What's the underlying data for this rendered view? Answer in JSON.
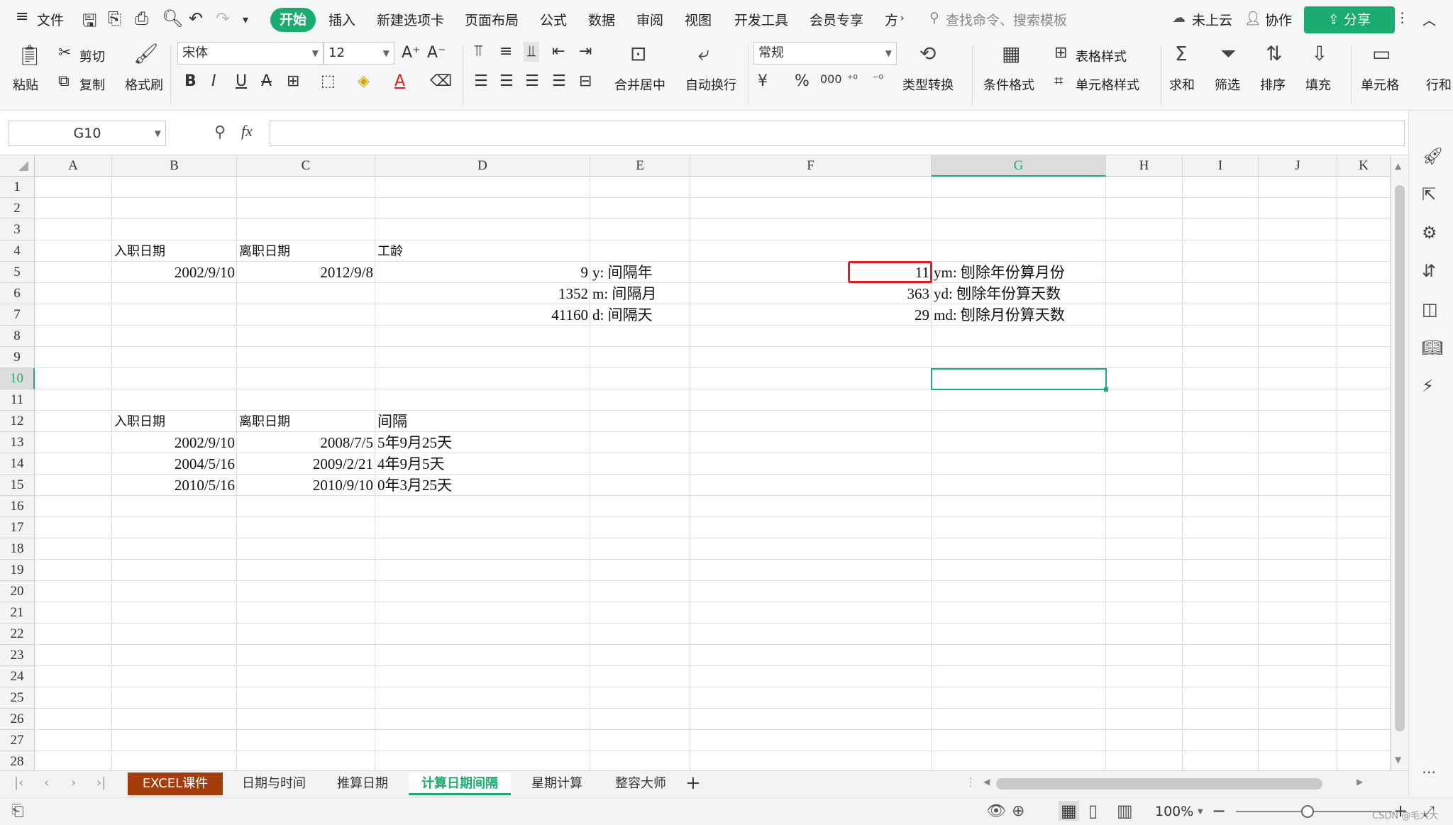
{
  "menu": {
    "file": "文件",
    "tabs": [
      "开始",
      "插入",
      "新建选项卡",
      "页面布局",
      "公式",
      "数据",
      "审阅",
      "视图",
      "开发工具",
      "会员专享",
      "方"
    ],
    "search_placeholder": "查找命令、搜索模板",
    "cloud": "未上云",
    "collab": "协作",
    "share": "分享"
  },
  "ribbon": {
    "paste": "粘贴",
    "cut": "剪切",
    "copy": "复制",
    "format_painter": "格式刷",
    "font_name": "宋体",
    "font_size": "12",
    "merge_center": "合并居中",
    "wrap": "自动换行",
    "number_format": "常规",
    "type_convert": "类型转换",
    "cond_format": "条件格式",
    "table_style": "表格样式",
    "cell_style": "单元格样式",
    "sum": "求和",
    "filter": "筛选",
    "sort": "排序",
    "fill": "填充",
    "cell": "单元格",
    "row": "行和"
  },
  "formula_bar": {
    "name_box": "G10",
    "fx": "fx",
    "content": ""
  },
  "columns": [
    "A",
    "B",
    "C",
    "D",
    "E",
    "F",
    "G",
    "H",
    "I",
    "J",
    "K"
  ],
  "rows": [
    "1",
    "2",
    "3",
    "4",
    "5",
    "6",
    "7",
    "8",
    "9",
    "10",
    "11",
    "12",
    "13",
    "14",
    "15",
    "16",
    "17",
    "18",
    "19",
    "20",
    "21",
    "22",
    "23",
    "24",
    "25",
    "26",
    "27",
    "28"
  ],
  "cells": {
    "B4": "入职日期",
    "C4": "离职日期",
    "D4": "工龄",
    "B5": "2002/9/10",
    "C5": "2012/9/8",
    "D5": "9",
    "E5": "y:  间隔年",
    "F5": "11",
    "G5": "ym:  刨除年份算月份",
    "D6": "1352",
    "E6": "m:  间隔月",
    "F6": "363",
    "G6": "yd:  刨除年份算天数",
    "D7": "41160",
    "E7": "d:  间隔天",
    "F7": "29",
    "G7": "md:  刨除月份算天数",
    "B12": "入职日期",
    "C12": "离职日期",
    "D12": "间隔",
    "B13": "2002/9/10",
    "C13": "2008/7/5",
    "D13": "5年9月25天",
    "B14": "2004/5/16",
    "C14": "2009/2/21",
    "D14": "4年9月5天",
    "B15": "2010/5/16",
    "C15": "2010/9/10",
    "D15": "0年3月25天"
  },
  "sheet_tabs": [
    "EXCEL课件",
    "日期与时间",
    "推算日期",
    "计算日期间隔",
    "星期计算",
    "整容大师"
  ],
  "status": {
    "zoom": "100%",
    "watermark": "CSDN @毛大大"
  },
  "colors": {
    "accent": "#1aad6f",
    "active_tab": "#1aad6f",
    "first_tab_bg": "#a43c0c",
    "highlight_box": "#e02020"
  }
}
